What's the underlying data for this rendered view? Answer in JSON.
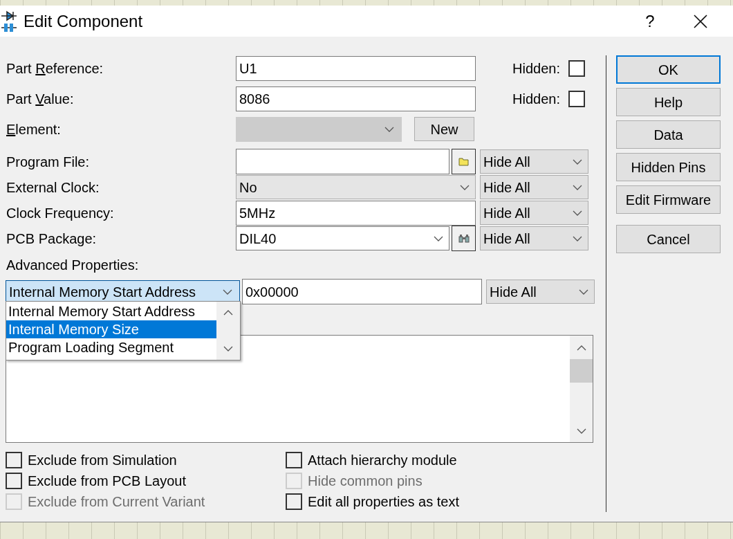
{
  "window": {
    "title": "Edit Component",
    "help": "?"
  },
  "fields": [
    {
      "kind": "text",
      "before": "Part ",
      "key": "R",
      "after": "eference:",
      "value": "U1",
      "hidden": {
        "label": "Hidden:",
        "checked": false
      }
    },
    {
      "kind": "text",
      "before": "Part ",
      "key": "V",
      "after": "alue:",
      "value": "8086",
      "hidden": {
        "label": "Hidden:",
        "checked": false
      }
    },
    {
      "kind": "element",
      "key": "E",
      "after": "lement:",
      "disabled": true,
      "button": "New"
    },
    {
      "kind": "file",
      "before": "Program File:",
      "visibility": "Hide All"
    },
    {
      "kind": "select",
      "before": "External Clock:",
      "value": "No",
      "visibility": "Hide All"
    },
    {
      "kind": "text",
      "before": "Clock Frequency:",
      "value": "5MHz",
      "visibility": "Hide All"
    },
    {
      "kind": "package",
      "before": "PCB Package:",
      "value": "DIL40",
      "visibility": "Hide All"
    }
  ],
  "advanced": {
    "label": "Advanced Properties:",
    "property": "Internal Memory Start Address",
    "value": "0x00000",
    "visibility": "Hide All",
    "expanded": true,
    "options": [
      {
        "label": "Internal Memory Start Address",
        "selected": false
      },
      {
        "label": "Internal Memory Size",
        "selected": true
      },
      {
        "label": "Program Loading Segment",
        "selected": false
      }
    ]
  },
  "checkboxes_left": [
    {
      "label": "Exclude from Simulation",
      "checked": false,
      "disabled": false
    },
    {
      "label": "Exclude from PCB Layout",
      "checked": false,
      "disabled": false
    },
    {
      "label": "Exclude from Current Variant",
      "checked": false,
      "disabled": true
    }
  ],
  "checkboxes_right": [
    {
      "label": "Attach hierarchy module",
      "checked": false,
      "disabled": false
    },
    {
      "label": "Hide common pins",
      "checked": false,
      "disabled": true
    },
    {
      "label": "Edit all properties as text",
      "checked": false,
      "disabled": false
    }
  ],
  "buttons": [
    {
      "label": "OK",
      "default": true
    },
    {
      "label": "Help",
      "default": false
    },
    {
      "label": "Data",
      "default": false
    },
    {
      "label": "Hidden Pins",
      "default": false
    },
    {
      "label": "Edit Firmware",
      "default": false
    },
    {
      "label": "Cancel",
      "default": false
    }
  ]
}
